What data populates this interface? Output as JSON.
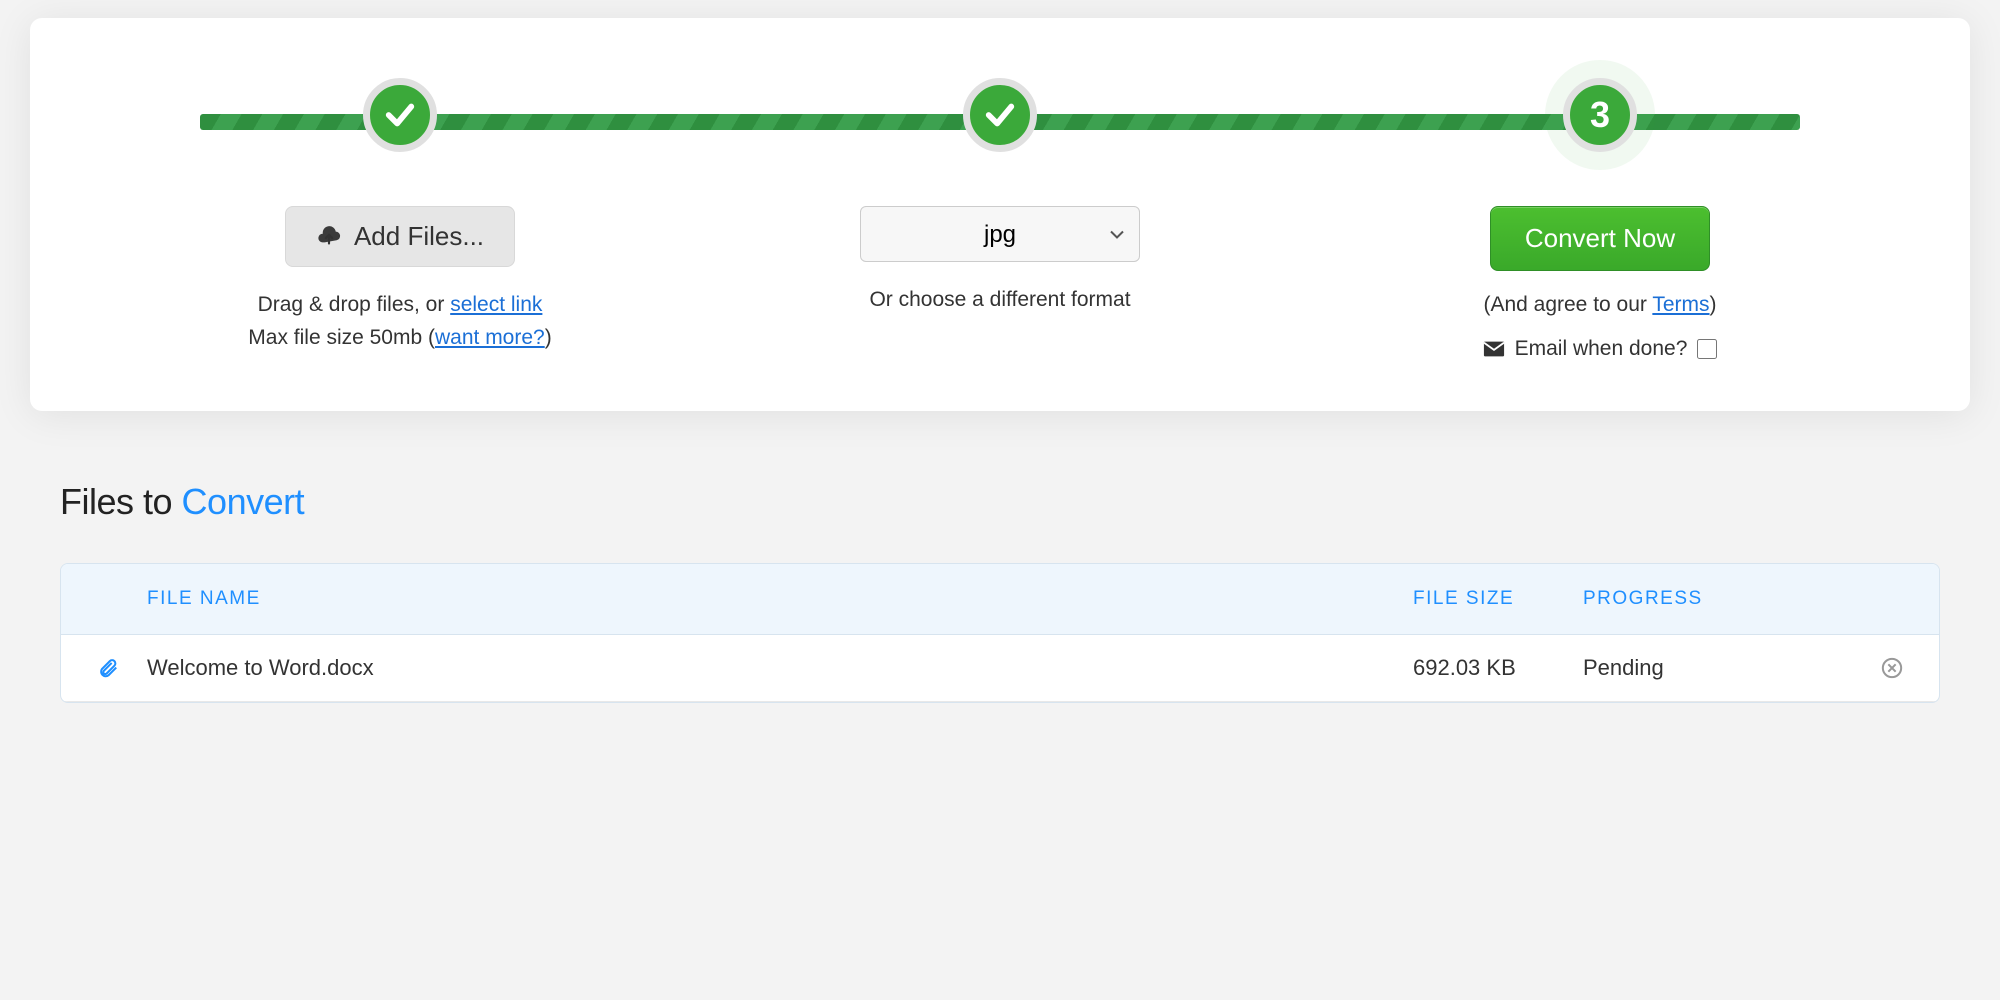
{
  "stepper": {
    "step3_label": "3"
  },
  "step1": {
    "add_files_label": "Add Files...",
    "drag_text_prefix": "Drag & drop files, or ",
    "select_link": "select link",
    "max_text_prefix": "Max file size 50mb (",
    "want_more_link": "want more?",
    "max_text_suffix": ")"
  },
  "step2": {
    "selected_format": "jpg",
    "help_text": "Or choose a different format"
  },
  "step3": {
    "convert_label": "Convert Now",
    "agree_prefix": "(And agree to our ",
    "terms_link": "Terms",
    "agree_suffix": ")",
    "email_label": "Email when done?"
  },
  "files_section": {
    "title_prefix": "Files to ",
    "title_accent": "Convert",
    "headers": {
      "name": "FILE NAME",
      "size": "FILE SIZE",
      "progress": "PROGRESS"
    },
    "rows": [
      {
        "name": "Welcome to Word.docx",
        "size": "692.03 KB",
        "progress": "Pending"
      }
    ]
  }
}
